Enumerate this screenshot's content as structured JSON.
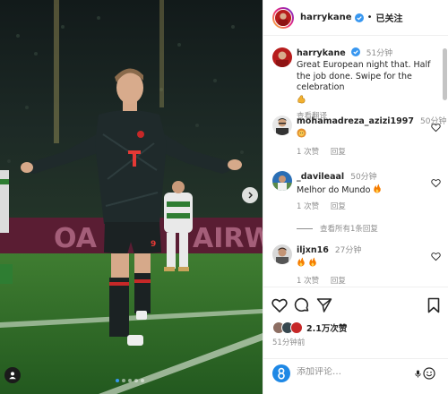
{
  "post": {
    "username": "harrykane",
    "follow_label": "已关注",
    "separator": "•",
    "caption": {
      "username": "harrykane",
      "time": "51分钟",
      "text": "Great European night that. Half the job done. Swipe for the celebration",
      "translate": "查看翻译"
    },
    "comments": [
      {
        "username": "mohamadreza_azizi1997",
        "time": "50分钟",
        "text": "",
        "emoji": "lion-face",
        "likes": "1 次赞",
        "reply": "回复"
      },
      {
        "username": "_davileaal",
        "time": "50分钟",
        "text": "Melhor do Mundo",
        "emoji": "fire",
        "likes": "1 次赞",
        "reply": "回复"
      },
      {
        "username": "iljxn16",
        "time": "27分钟",
        "text": "",
        "emoji": "fire fire",
        "likes": "1 次赞",
        "reply": "回复"
      }
    ],
    "view_replies": "查看所有1条回复",
    "likes_text": "2.1万次赞",
    "post_time": "51分钟前",
    "comment_placeholder": "添加评论…",
    "carousel": {
      "slides": 5,
      "active": 0
    },
    "colors": {
      "verified": "#3897f0",
      "accent": "#3897f0",
      "kit_dark": "#1f2a2b",
      "kit_number": "#e53935",
      "pitch": "#2f6f2a"
    }
  }
}
